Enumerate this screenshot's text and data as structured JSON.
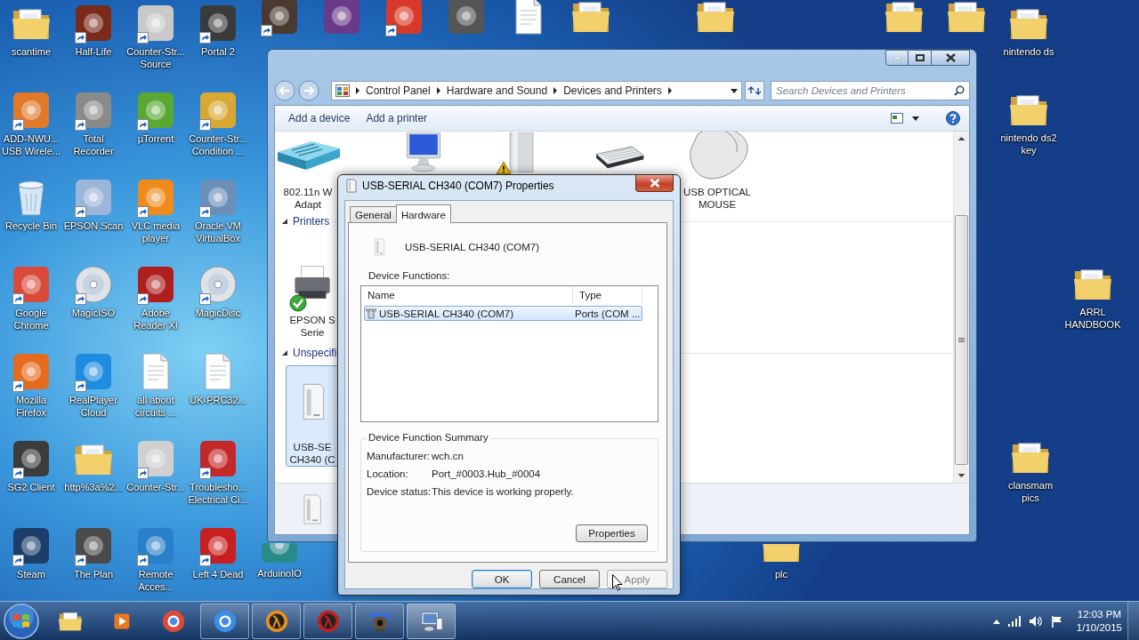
{
  "desktop": {
    "icons": [
      {
        "label": "scantime",
        "kind": "folder",
        "shortcut": false
      },
      {
        "label": "Half-Life",
        "kind": "app",
        "color": "#7a2a18",
        "shortcut": true
      },
      {
        "label": "Counter-Str...\nSource",
        "kind": "app",
        "color": "#c9c9c9",
        "shortcut": true
      },
      {
        "label": "Portal 2",
        "kind": "app",
        "color": "#3a3a3a",
        "shortcut": true
      },
      {
        "label": "ADD-NWU...\nUSB Wirele...",
        "kind": "app",
        "color": "#e07a2a",
        "shortcut": true
      },
      {
        "label": "Total\nRecorder",
        "kind": "app",
        "color": "#8a8a8a",
        "shortcut": true
      },
      {
        "label": "µTorrent",
        "kind": "app",
        "color": "#5aa832",
        "shortcut": true
      },
      {
        "label": "Counter-Str...\nCondition ...",
        "kind": "app",
        "color": "#d8a832",
        "shortcut": true
      },
      {
        "label": "Recycle Bin",
        "kind": "recycle",
        "shortcut": false
      },
      {
        "label": "EPSON Scan",
        "kind": "app",
        "color": "#9bb6d8",
        "shortcut": true
      },
      {
        "label": "VLC media\nplayer",
        "kind": "app",
        "color": "#f08a1c",
        "shortcut": true
      },
      {
        "label": "Oracle VM\nVirtualBox",
        "kind": "app",
        "color": "#6a8fb8",
        "shortcut": true
      },
      {
        "label": "Google\nChrome",
        "kind": "app",
        "color": "#d94a3a",
        "shortcut": true
      },
      {
        "label": "MagicISO",
        "kind": "disc",
        "shortcut": true
      },
      {
        "label": "Adobe\nReader XI",
        "kind": "app",
        "color": "#b01e1e",
        "shortcut": true
      },
      {
        "label": "MagicDisc",
        "kind": "disc",
        "shortcut": true
      },
      {
        "label": "Mozilla\nFirefox",
        "kind": "app",
        "color": "#e56b1f",
        "shortcut": true
      },
      {
        "label": "RealPlayer\nCloud",
        "kind": "app",
        "color": "#1e8ce0",
        "shortcut": true
      },
      {
        "label": "all about\ncircuits ...",
        "kind": "document",
        "shortcut": false
      },
      {
        "label": "UK-PRC32...",
        "kind": "document",
        "shortcut": false
      },
      {
        "label": "SG2 Client",
        "kind": "app",
        "color": "#3c3c3c",
        "shortcut": true
      },
      {
        "label": "http%3a%2...",
        "kind": "folder",
        "shortcut": false
      },
      {
        "label": "Counter-Str...",
        "kind": "app",
        "color": "#d0d0d0",
        "shortcut": true
      },
      {
        "label": "Troublesho...\nElectrical Ci...",
        "kind": "app",
        "color": "#c42828",
        "shortcut": true
      },
      {
        "label": "Steam",
        "kind": "app",
        "color": "#1b3e6a",
        "shortcut": true
      },
      {
        "label": "The Plan",
        "kind": "app",
        "color": "#4a4a4a",
        "shortcut": true
      },
      {
        "label": "Remote\nAcces...",
        "kind": "app",
        "color": "#2a7fc8",
        "shortcut": true
      },
      {
        "label": "Left 4 Dead",
        "kind": "app",
        "color": "#c82020",
        "shortcut": true
      }
    ],
    "more_icons": [
      {
        "label": "ArduinoIO",
        "kind": "app",
        "color": "#2a8a8a",
        "shortcut": false
      },
      {
        "label": "nintendo ds",
        "kind": "folder",
        "shortcut": false
      },
      {
        "label": "nintendo ds2\nkey",
        "kind": "folder",
        "shortcut": false
      },
      {
        "label": "ARRL\nHANDBOOK",
        "kind": "folder",
        "shortcut": false
      },
      {
        "label": "clansmam\npics",
        "kind": "folder",
        "shortcut": false
      },
      {
        "label": "plc",
        "kind": "folder",
        "shortcut": false
      }
    ],
    "top_icons": [
      {
        "kind": "app",
        "color": "#4a3a30",
        "shortcut": true
      },
      {
        "kind": "app",
        "color": "#6a3a8a",
        "shortcut": false
      },
      {
        "kind": "app",
        "color": "#d83a2a",
        "shortcut": true
      },
      {
        "kind": "app",
        "color": "#555555",
        "shortcut": false
      },
      {
        "kind": "document",
        "shortcut": false
      },
      {
        "kind": "folder",
        "shortcut": false
      },
      {
        "kind": "folder",
        "shortcut": false
      },
      {
        "kind": "folder",
        "shortcut": false
      },
      {
        "kind": "folder",
        "shortcut": false
      }
    ]
  },
  "explorer": {
    "breadcrumb": [
      "Control Panel",
      "Hardware and Sound",
      "Devices and Printers"
    ],
    "search": {
      "placeholder": "Search Devices and Printers"
    },
    "commands": [
      "Add a device",
      "Add a printer"
    ],
    "devices": [
      {
        "kind": "router",
        "label": "802.11n W\nAdapt",
        "selected": false
      },
      {
        "kind": "monitor",
        "selected": false
      },
      {
        "kind": "computer",
        "warning": true,
        "selected": false
      },
      {
        "kind": "keyboard",
        "selected": false
      },
      {
        "kind": "mouse",
        "label": "USB OPTICAL\nMOUSE",
        "selected": false
      }
    ],
    "sections": [
      {
        "title": "Printers",
        "expanded": true,
        "items": [
          {
            "kind": "printer",
            "default": true,
            "label": "EPSON S\nSerie",
            "selected": false
          }
        ]
      },
      {
        "title": "Unspecifi",
        "expanded": true,
        "items": [
          {
            "kind": "usb",
            "label": "USB-SE\nCH340 (C",
            "selected": true
          }
        ]
      }
    ],
    "details": {
      "kind": "usb"
    }
  },
  "dialog": {
    "title": "USB-SERIAL CH340 (COM7) Properties",
    "tabs": [
      {
        "label": "General",
        "selected": false
      },
      {
        "label": "Hardware",
        "selected": true
      }
    ],
    "device_name": "USB-SERIAL CH340 (COM7)",
    "functions_label": "Device Functions:",
    "columns": [
      "Name",
      "Type"
    ],
    "rows": [
      {
        "name": "USB-SERIAL CH340 (COM7)",
        "type": "Ports (COM ...",
        "selected": true
      }
    ],
    "summary": {
      "title": "Device Function Summary",
      "fields": [
        {
          "label": "Manufacturer:",
          "value": "wch.cn"
        },
        {
          "label": "Location:",
          "value": "Port_#0003.Hub_#0004"
        },
        {
          "label": "Device status:",
          "value": "This device is working properly."
        }
      ]
    },
    "properties_button": "Properties",
    "buttons": [
      {
        "label": "OK",
        "default": true,
        "disabled": false
      },
      {
        "label": "Cancel",
        "default": false,
        "disabled": false
      },
      {
        "label": "Apply",
        "default": false,
        "disabled": true
      }
    ]
  },
  "taskbar": {
    "items": [
      {
        "kind": "folder",
        "running": false,
        "selected": false
      },
      {
        "kind": "media",
        "color": "#e8781e",
        "running": false,
        "selected": false
      },
      {
        "kind": "browser",
        "color": "#dd4b39",
        "running": false,
        "selected": false
      },
      {
        "kind": "browser",
        "color": "#3a8ee6",
        "running": true,
        "selected": false
      },
      {
        "kind": "game",
        "color": "#e8901e",
        "running": true,
        "selected": false
      },
      {
        "kind": "game",
        "color": "#c02020",
        "running": true,
        "selected": false
      },
      {
        "kind": "camera",
        "color": "#6a5030",
        "running": true,
        "selected": false
      },
      {
        "kind": "devices",
        "color": "#5a8ac8",
        "running": true,
        "selected": true
      }
    ],
    "clock": {
      "time": "12:03 PM",
      "date": "1/10/2015"
    }
  }
}
